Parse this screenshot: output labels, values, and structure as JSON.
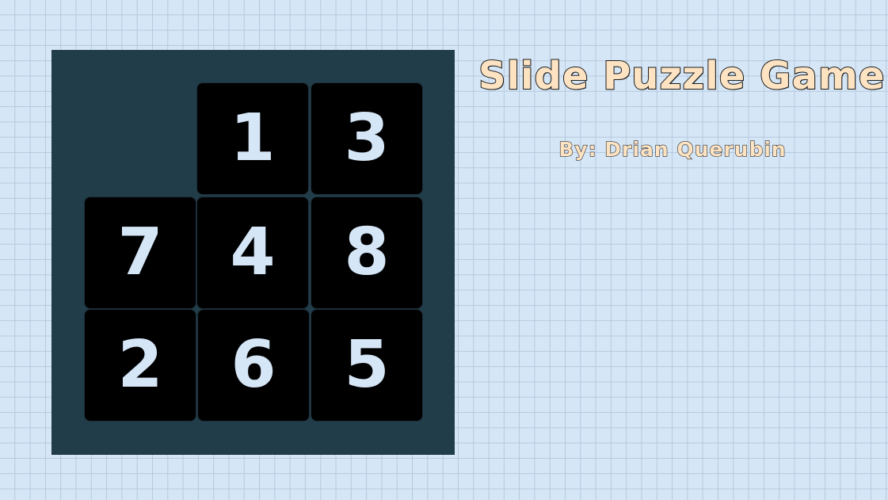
{
  "header": {
    "title": "Slide Puzzle Game",
    "byline": "By: Drian Querubin"
  },
  "board": {
    "rows": 3,
    "cols": 3,
    "tiles": [
      {
        "row": 0,
        "col": 0,
        "label": ""
      },
      {
        "row": 0,
        "col": 1,
        "label": "1"
      },
      {
        "row": 0,
        "col": 2,
        "label": "3"
      },
      {
        "row": 1,
        "col": 0,
        "label": "7"
      },
      {
        "row": 1,
        "col": 1,
        "label": "4"
      },
      {
        "row": 1,
        "col": 2,
        "label": "8"
      },
      {
        "row": 2,
        "col": 0,
        "label": "2"
      },
      {
        "row": 2,
        "col": 1,
        "label": "6"
      },
      {
        "row": 2,
        "col": 2,
        "label": "5"
      }
    ]
  },
  "colors": {
    "page_background": "#d5e6f7",
    "grid_lines": "#b6c9dc",
    "board_frame": "#213d49",
    "tile_background": "#000000",
    "tile_text": "#d5e6f7",
    "title_text": "#fde3c2"
  }
}
